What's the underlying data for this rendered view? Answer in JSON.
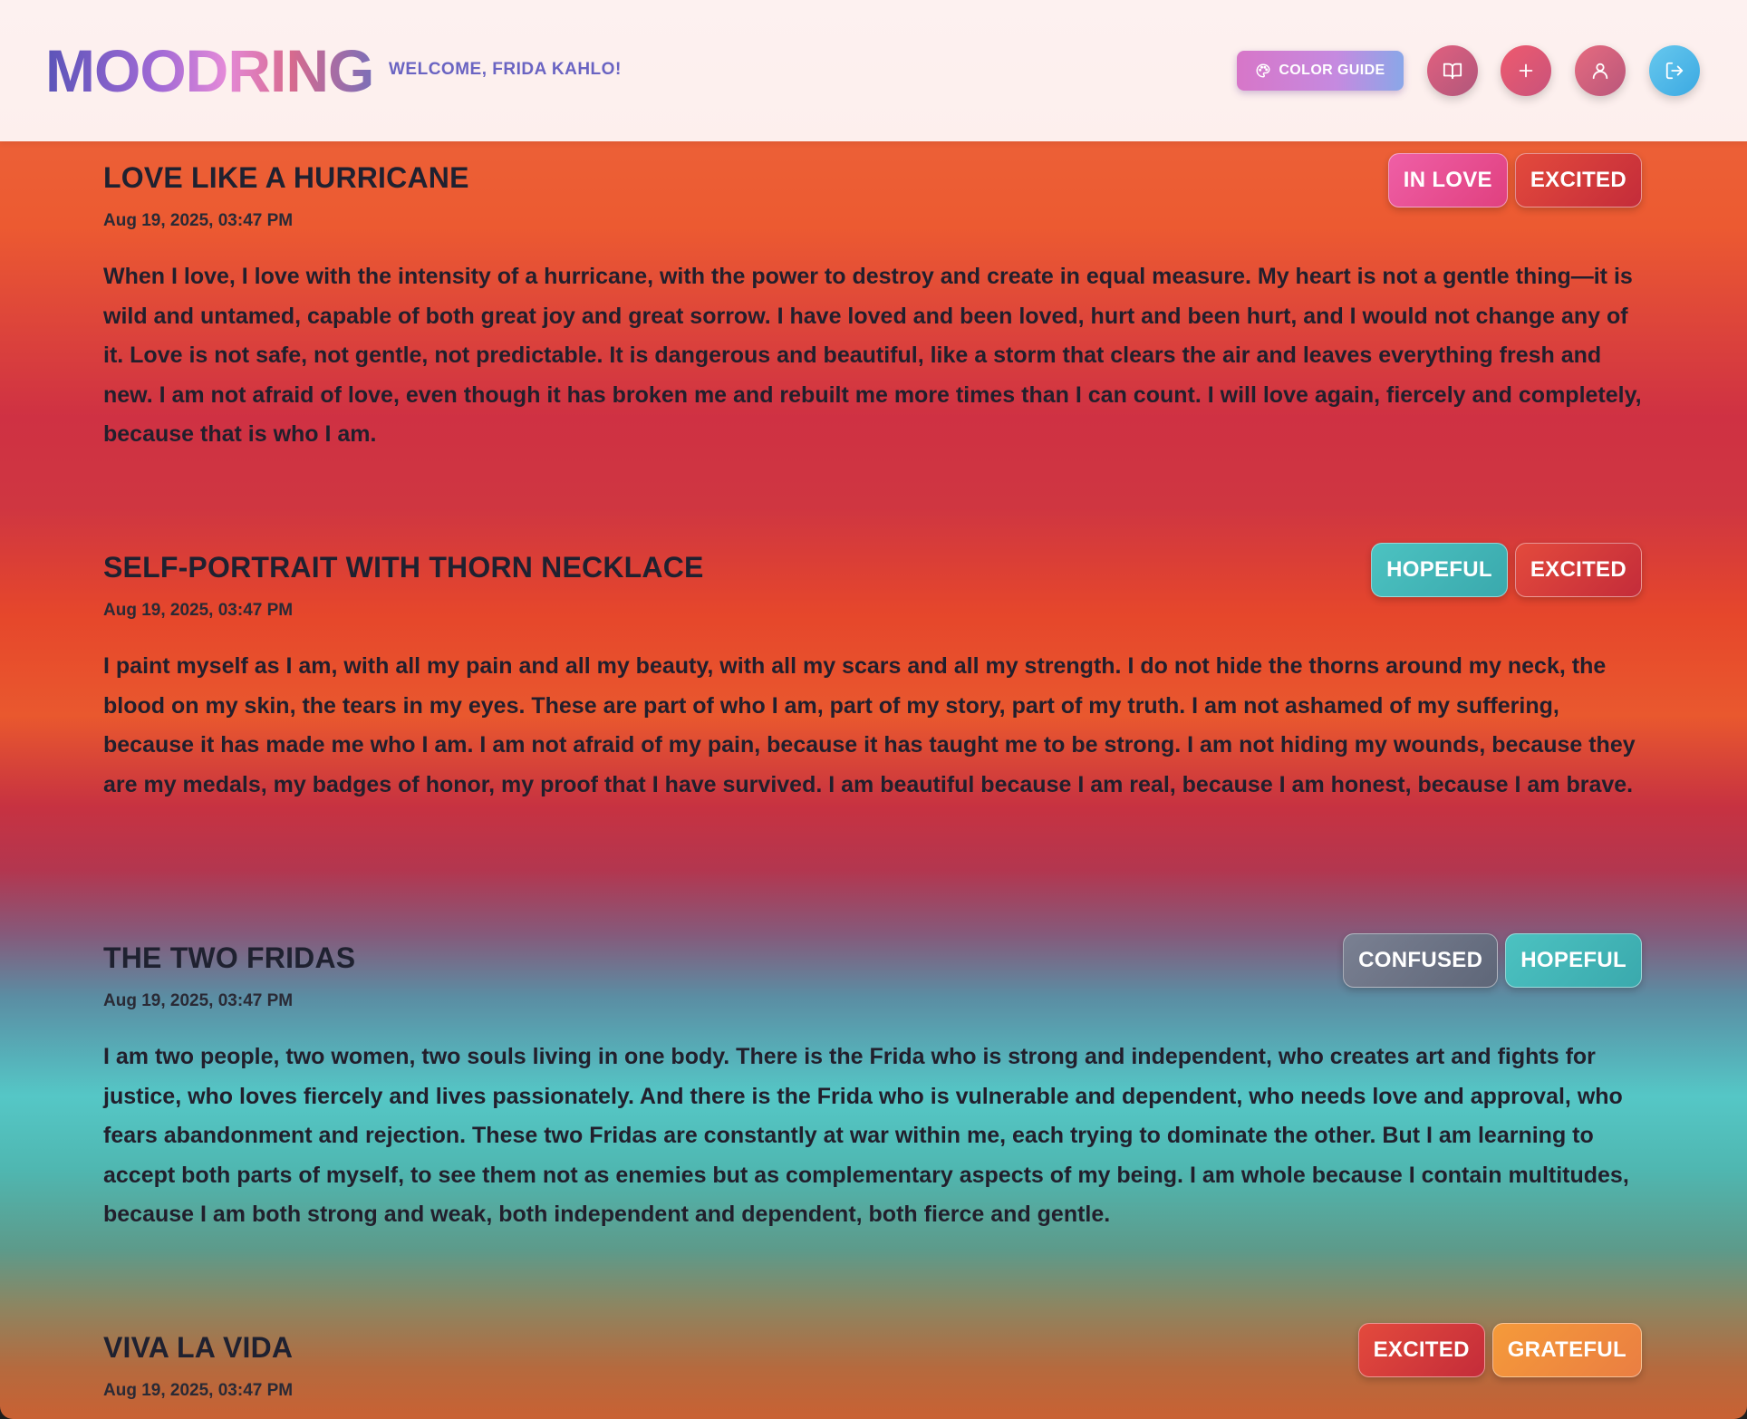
{
  "header": {
    "logo": "MOODRING",
    "welcome": "WELCOME, FRIDA KAHLO!",
    "color_guide_label": "COLOR GUIDE"
  },
  "icons": {
    "color_guide": "palette-icon",
    "journal": "book-open-icon",
    "add": "plus-icon",
    "profile": "user-icon",
    "logout": "log-out-icon"
  },
  "colors": {
    "in_love": "#e84d8f",
    "excited": "#d33a3b",
    "hopeful": "#43b6b7",
    "confused": "#6b7285",
    "grateful": "#f08c3e",
    "logout": "#4fb8e8"
  },
  "entries": [
    {
      "title": "LOVE LIKE A HURRICANE",
      "date": "Aug 19, 2025, 03:47 PM",
      "tags": [
        "IN LOVE",
        "EXCITED"
      ],
      "body": "When I love, I love with the intensity of a hurricane, with the power to destroy and create in equal measure. My heart is not a gentle thing—it is wild and untamed, capable of both great joy and great sorrow. I have loved and been loved, hurt and been hurt, and I would not change any of it. Love is not safe, not gentle, not predictable. It is dangerous and beautiful, like a storm that clears the air and leaves everything fresh and new. I am not afraid of love, even though it has broken me and rebuilt me more times than I can count. I will love again, fiercely and completely, because that is who I am."
    },
    {
      "title": "SELF-PORTRAIT WITH THORN NECKLACE",
      "date": "Aug 19, 2025, 03:47 PM",
      "tags": [
        "HOPEFUL",
        "EXCITED"
      ],
      "body": "I paint myself as I am, with all my pain and all my beauty, with all my scars and all my strength. I do not hide the thorns around my neck, the blood on my skin, the tears in my eyes. These are part of who I am, part of my story, part of my truth. I am not ashamed of my suffering, because it has made me who I am. I am not afraid of my pain, because it has taught me to be strong. I am not hiding my wounds, because they are my medals, my badges of honor, my proof that I have survived. I am beautiful because I am real, because I am honest, because I am brave."
    },
    {
      "title": "THE TWO FRIDAS",
      "date": "Aug 19, 2025, 03:47 PM",
      "tags": [
        "CONFUSED",
        "HOPEFUL"
      ],
      "body": "I am two people, two women, two souls living in one body. There is the Frida who is strong and independent, who creates art and fights for justice, who loves fiercely and lives passionately. And there is the Frida who is vulnerable and dependent, who needs love and approval, who fears abandonment and rejection. These two Fridas are constantly at war within me, each trying to dominate the other. But I am learning to accept both parts of myself, to see them not as enemies but as complementary aspects of my being. I am whole because I contain multitudes, because I am both strong and weak, both independent and dependent, both fierce and gentle."
    },
    {
      "title": "VIVA LA VIDA",
      "date": "Aug 19, 2025, 03:47 PM",
      "tags": [
        "EXCITED",
        "GRATEFUL"
      ],
      "body": ""
    }
  ]
}
